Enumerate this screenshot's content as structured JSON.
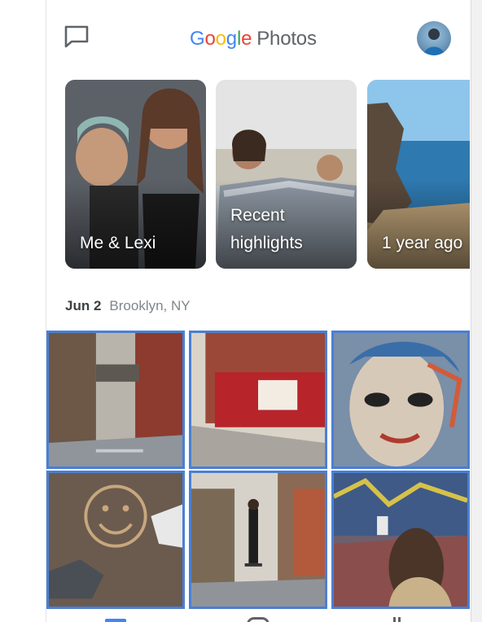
{
  "header": {
    "title_letters": [
      "G",
      "o",
      "o",
      "g",
      "l",
      "e"
    ],
    "title_suffix": "Photos",
    "chat_icon": "chat-bubble-icon",
    "avatar_icon": "account-avatar"
  },
  "memories": [
    {
      "label": "Me & Lexi"
    },
    {
      "label": "Recent\nhighlights"
    },
    {
      "label": "1 year ago"
    }
  ],
  "section": {
    "date": "Jun 2",
    "location": "Brooklyn, NY"
  },
  "grid": {
    "photos": [
      "street-alley-photo",
      "red-storefront-photo",
      "graffiti-face-photo",
      "smiley-sidewalk-photo",
      "skater-alley-photo",
      "graffiti-wall-photo"
    ],
    "selection_color": "#4a7fd4"
  },
  "bottom_nav": {
    "items": [
      "photos-nav-icon",
      "search-nav-icon",
      "library-nav-icon"
    ],
    "active_color": "#4285F4"
  },
  "colors": {
    "google_blue": "#4285F4",
    "google_red": "#EA4335",
    "google_yellow": "#FBBC05",
    "google_green": "#34A853",
    "text_dark": "#3c4043",
    "text_muted": "#80868b"
  }
}
